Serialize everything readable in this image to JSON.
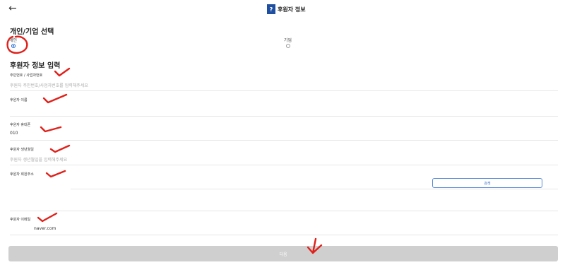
{
  "header": {
    "back_icon": "←",
    "logo_glyph": "?",
    "title": "후원자 정보"
  },
  "selection": {
    "title": "개인/기업 선택",
    "options": [
      {
        "label": "개인",
        "checked": true
      },
      {
        "label": "기업",
        "checked": false
      }
    ]
  },
  "form": {
    "title": "후원자 정보 입력",
    "fields": [
      {
        "label": "주민번호 / 사업자번호",
        "value": "",
        "placeholder": "후원자 주민번호/사업자번호를 입력해주세요"
      },
      {
        "label": "후원자 이름",
        "value": "",
        "placeholder": ""
      },
      {
        "label": "후원자 휴대폰",
        "value": "010",
        "placeholder": ""
      },
      {
        "label": "후원자 생년월일",
        "value": "",
        "placeholder": "후원자 생년월일을 입력해주세요"
      },
      {
        "label": "후원자 회원주소",
        "value": "",
        "placeholder": "",
        "button_label": "검색"
      },
      {
        "label": "후원자 이메일",
        "value": "naver.com",
        "placeholder": ""
      }
    ]
  },
  "next_button": {
    "label": "다음"
  },
  "colors": {
    "accent": "#1a66d6",
    "annotation": "#e0201a",
    "disabled_button": "#cfcfcf"
  }
}
